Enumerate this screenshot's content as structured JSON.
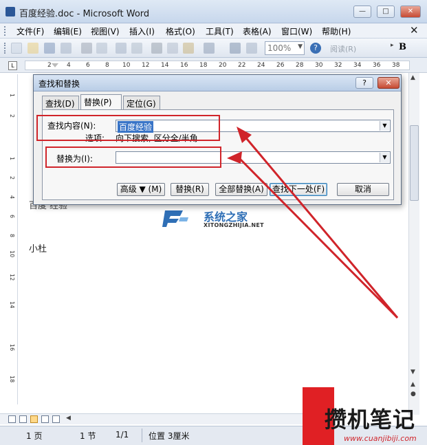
{
  "window": {
    "title": "百度经验.doc - Microsoft Word",
    "minimize": "—",
    "maximize": "□",
    "close": "✕"
  },
  "menu": {
    "items": [
      "文件(F)",
      "编辑(E)",
      "视图(V)",
      "插入(I)",
      "格式(O)",
      "工具(T)",
      "表格(A)",
      "窗口(W)",
      "帮助(H)"
    ],
    "close": "✕"
  },
  "toolbar": {
    "zoom": "100%",
    "read_label": "阅读(R)",
    "bold_label": "B",
    "help_icon": "?"
  },
  "ruler": {
    "tab_selector": "L",
    "numbers": [
      "2",
      "4",
      "6",
      "8",
      "10",
      "12",
      "14",
      "16",
      "18",
      "20",
      "22",
      "24",
      "26",
      "28",
      "30",
      "32",
      "34",
      "36",
      "38"
    ]
  },
  "vruler": {
    "numbers": [
      "1",
      "2",
      "1",
      "2",
      "4",
      "6",
      "8",
      "10",
      "12",
      "14",
      "16",
      "18"
    ]
  },
  "document": {
    "line_fragment": "百度 经验",
    "author": "小杜"
  },
  "dialog": {
    "title": "查找和替换",
    "help_button": "?",
    "close_button": "✕",
    "tabs": [
      "查找(D)",
      "替换(P)",
      "定位(G)"
    ],
    "active_tab": 1,
    "find_label": "查找内容(N):",
    "find_value": "百度经验",
    "options_label": "选项:",
    "options_value": "向下搜索, 区分全/半角",
    "replace_label": "替换为(I):",
    "replace_value": "",
    "buttons": {
      "more": "高级 ▼ (M)",
      "replace": "替换(R)",
      "replace_all": "全部替换(A)",
      "find_next": "查找下一处(F)",
      "cancel": "取消"
    }
  },
  "status": {
    "page": "1 页",
    "section": "1 节",
    "position": "1/1",
    "at": "位置 3厘米"
  },
  "watermark_site": {
    "name": "系统之家",
    "domain": "XITONGZHIJIA.NET"
  },
  "watermark_brand": {
    "name": "攒机笔记",
    "domain": "www.cuanjibiji.com"
  },
  "colors": {
    "highlight": "#d0242a",
    "selection": "#3874c7"
  }
}
